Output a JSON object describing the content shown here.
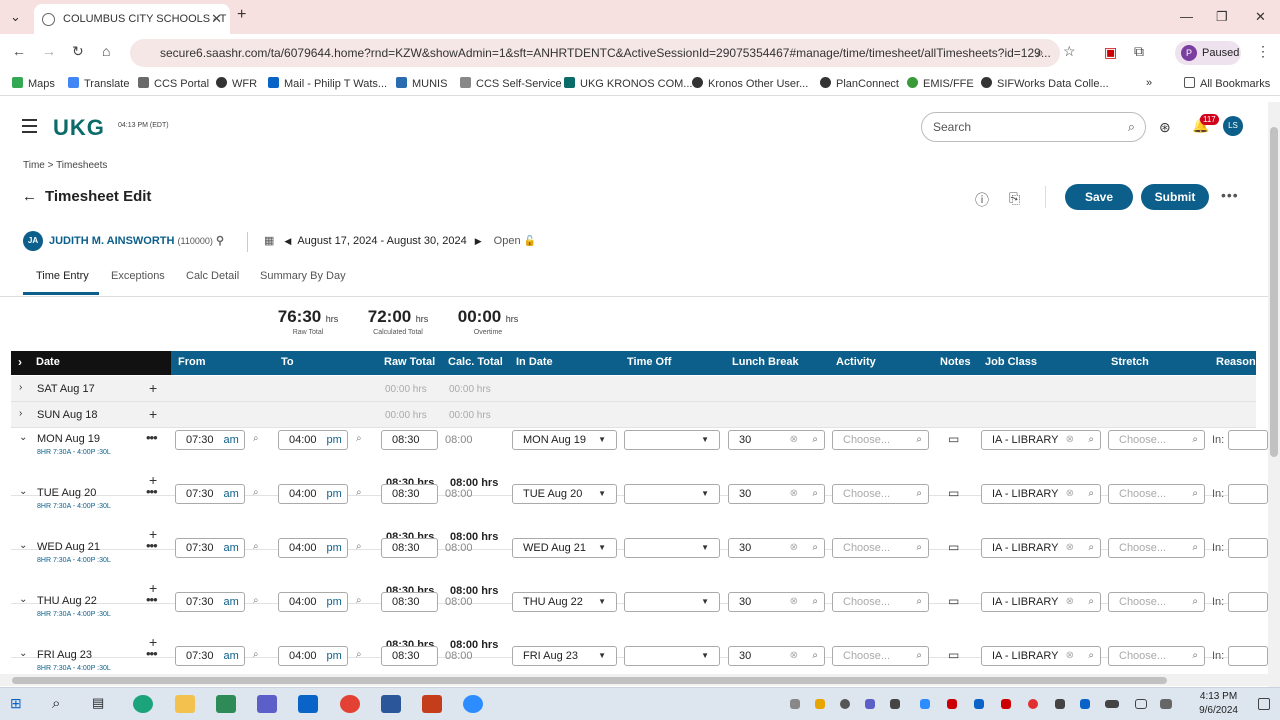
{
  "browser": {
    "tab_title": "COLUMBUS CITY SCHOOLS - T",
    "url": "secure6.saashr.com/ta/6079644.home?rnd=KZW&showAdmin=1&sft=ANHRTDENTC&ActiveSessionId=29075354467#manage/time/timesheet/allTimesheets?id=129...",
    "profile_status": "Paused",
    "profile_initial": "P",
    "bookmarks": [
      "Maps",
      "Translate",
      "CCS Portal",
      "WFR",
      "Mail - Philip T Wats...",
      "MUNIS",
      "CCS Self-Service",
      "UKG KRONOS COM...",
      "Kronos Other User...",
      "PlanConnect",
      "EMIS/FFE",
      "SIFWorks Data Colle..."
    ],
    "all_bookmarks": "All Bookmarks"
  },
  "app": {
    "logo": "UKG",
    "clock": "04:13 PM (EDT)",
    "search_placeholder": "Search",
    "notif_count": "117",
    "user_initials": "LS"
  },
  "breadcrumb": "Time  >  Timesheets",
  "page_title": "Timesheet Edit",
  "actions": {
    "save": "Save",
    "submit": "Submit"
  },
  "employee": {
    "initials": "JA",
    "name": "JUDITH M. AINSWORTH",
    "id": "(110000)"
  },
  "period": {
    "range": "August 17, 2024 - August 30, 2024",
    "status": "Open"
  },
  "tabs": [
    "Time Entry",
    "Exceptions",
    "Calc Detail",
    "Summary By Day"
  ],
  "totals": [
    {
      "value": "76:30",
      "unit": "hrs",
      "label": "Raw Total"
    },
    {
      "value": "72:00",
      "unit": "hrs",
      "label": "Calculated Total"
    },
    {
      "value": "00:00",
      "unit": "hrs",
      "label": "Overtime"
    }
  ],
  "columns": [
    "Date",
    "From",
    "To",
    "Raw Total",
    "Calc. Total",
    "In Date",
    "Time Off",
    "Lunch Break",
    "Activity",
    "Notes",
    "Job Class",
    "Stretch",
    "Reason"
  ],
  "weekend_rows": [
    {
      "date": "SAT Aug 17",
      "raw": "00:00 hrs",
      "calc": "00:00 hrs"
    },
    {
      "date": "SUN Aug 18",
      "raw": "00:00 hrs",
      "calc": "00:00 hrs"
    }
  ],
  "day_rows": [
    {
      "date": "MON Aug 19",
      "schedule": "8HR 7:30A - 4:00P :30L",
      "from": "07:30",
      "from_ampm": "am",
      "to": "04:00",
      "to_ampm": "pm",
      "raw": "08:30",
      "calc": "08:00",
      "in_date": "MON Aug 19",
      "lunch": "30",
      "activity": "Choose...",
      "job_class": "IA - LIBRARY",
      "stretch": "Choose...",
      "reason": "In:",
      "raw_total": "08:30 hrs",
      "calc_total": "08:00 hrs"
    },
    {
      "date": "TUE Aug 20",
      "schedule": "8HR 7:30A - 4:00P :30L",
      "from": "07:30",
      "from_ampm": "am",
      "to": "04:00",
      "to_ampm": "pm",
      "raw": "08:30",
      "calc": "08:00",
      "in_date": "TUE Aug 20",
      "lunch": "30",
      "activity": "Choose...",
      "job_class": "IA - LIBRARY",
      "stretch": "Choose...",
      "reason": "In:",
      "raw_total": "08:30 hrs",
      "calc_total": "08:00 hrs"
    },
    {
      "date": "WED Aug 21",
      "schedule": "8HR 7:30A - 4:00P :30L",
      "from": "07:30",
      "from_ampm": "am",
      "to": "04:00",
      "to_ampm": "pm",
      "raw": "08:30",
      "calc": "08:00",
      "in_date": "WED Aug 21",
      "lunch": "30",
      "activity": "Choose...",
      "job_class": "IA - LIBRARY",
      "stretch": "Choose...",
      "reason": "In:",
      "raw_total": "08:30 hrs",
      "calc_total": "08:00 hrs"
    },
    {
      "date": "THU Aug 22",
      "schedule": "8HR 7:30A - 4:00P :30L",
      "from": "07:30",
      "from_ampm": "am",
      "to": "04:00",
      "to_ampm": "pm",
      "raw": "08:30",
      "calc": "08:00",
      "in_date": "THU Aug 22",
      "lunch": "30",
      "activity": "Choose...",
      "job_class": "IA - LIBRARY",
      "stretch": "Choose...",
      "reason": "In:",
      "raw_total": "08:30 hrs",
      "calc_total": "08:00 hrs"
    },
    {
      "date": "FRI Aug 23",
      "schedule": "8HR 7:30A - 4:00P :30L",
      "from": "07:30",
      "from_ampm": "am",
      "to": "04:00",
      "to_ampm": "pm",
      "raw": "08:30",
      "calc": "08:00",
      "in_date": "FRI Aug 23",
      "lunch": "30",
      "activity": "Choose...",
      "job_class": "IA - LIBRARY",
      "stretch": "Choose...",
      "reason": "In:",
      "raw_total": "",
      "calc_total": ""
    }
  ],
  "system": {
    "time": "4:13 PM",
    "date": "9/6/2024"
  },
  "colors": {
    "brand": "#0b5f8a",
    "logo": "#0a6b68",
    "tabbar": "#f6e0e0"
  }
}
